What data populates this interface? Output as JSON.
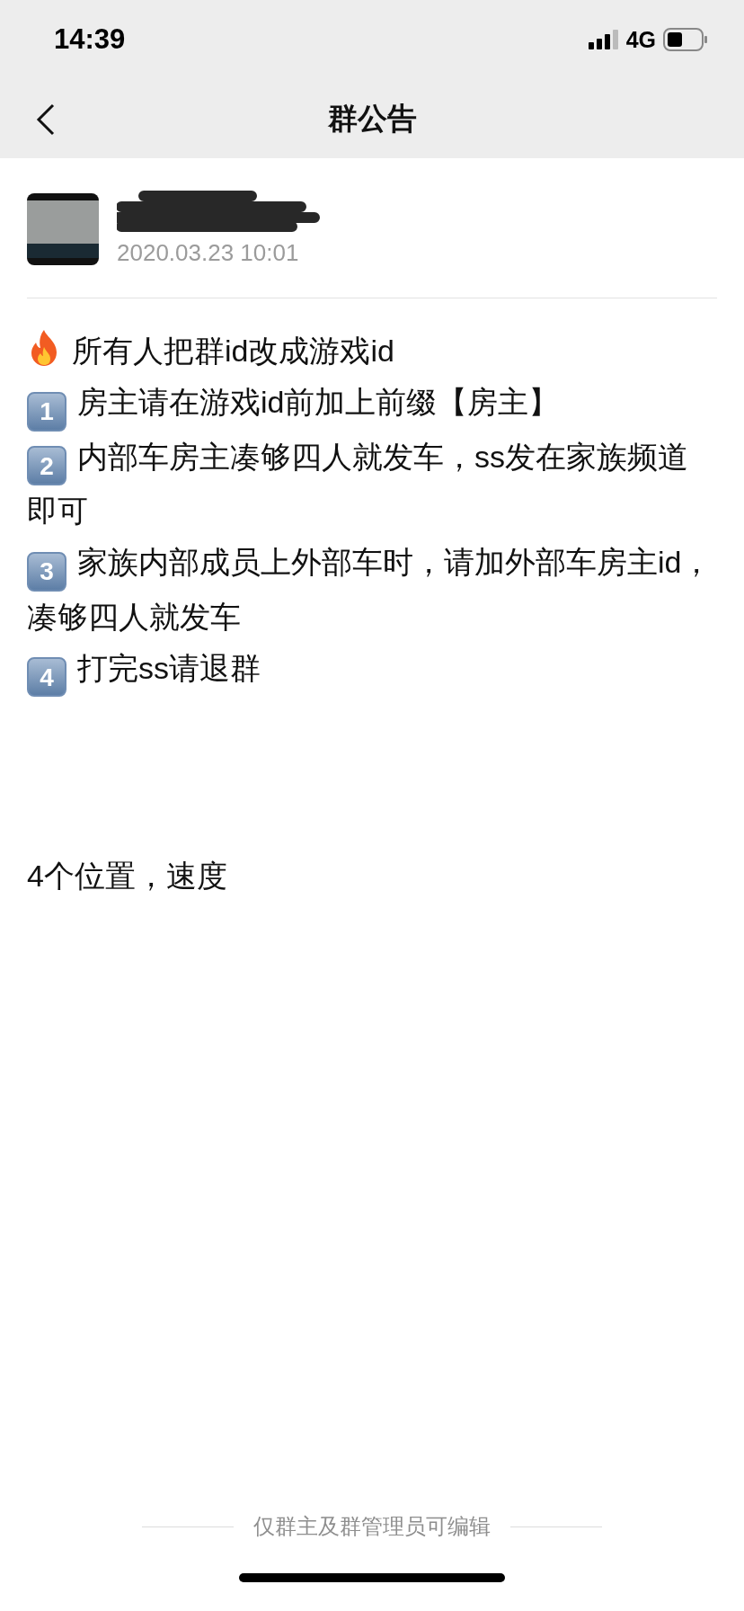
{
  "status_bar": {
    "time": "14:39",
    "network": "4G"
  },
  "nav": {
    "title": "群公告"
  },
  "author": {
    "date": "2020.03.23  10:01"
  },
  "lines": [
    {
      "kind": "fire",
      "text": "所有人把群id改成游戏id"
    },
    {
      "kind": "number",
      "number": "1",
      "text": "房主请在游戏id前加上前缀【房主】"
    },
    {
      "kind": "number",
      "number": "2",
      "text": "内部车房主凑够四人就发车，ss发在家族频道即可"
    },
    {
      "kind": "number",
      "number": "3",
      "text": "家族内部成员上外部车时，请加外部车房主id，凑够四人就发车"
    },
    {
      "kind": "number",
      "number": "4",
      "text": "打完ss请退群"
    }
  ],
  "note": "4个位置，速度",
  "footer": "仅群主及群管理员可编辑"
}
